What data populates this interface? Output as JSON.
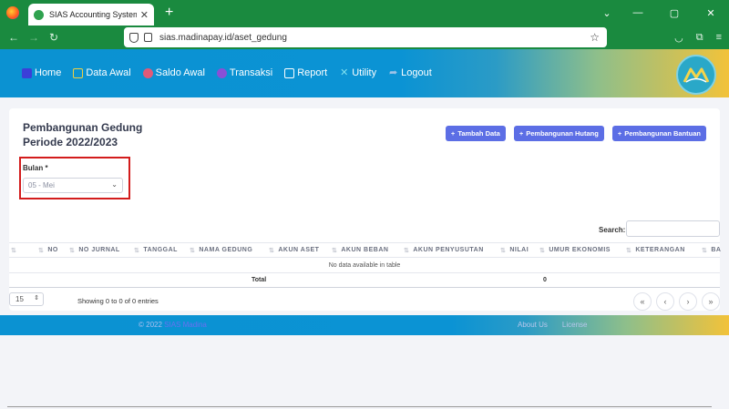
{
  "browser": {
    "tab_title": "SIAS Accounting System",
    "tab_close": "✕",
    "new_tab": "+",
    "url": "sias.madinapay.id/aset_gedung",
    "window_controls": [
      "⌄",
      "—",
      "▢",
      "✕"
    ]
  },
  "menu": {
    "items": [
      {
        "label": "Home",
        "icon": "home-icon",
        "color": "#3b3fd8"
      },
      {
        "label": "Data Awal",
        "icon": "monitor-icon",
        "color": "#f2d040"
      },
      {
        "label": "Saldo Awal",
        "icon": "wallet-icon",
        "color": "#e05a78"
      },
      {
        "label": "Transaksi",
        "icon": "transaction-icon",
        "color": "#8a4fd6"
      },
      {
        "label": "Report",
        "icon": "report-icon",
        "color": "#ffffff"
      },
      {
        "label": "Utility",
        "icon": "utility-icon",
        "color": "#7fe0f0"
      },
      {
        "label": "Logout",
        "icon": "logout-icon",
        "color": "#9fc3e8"
      }
    ]
  },
  "page": {
    "title_line1": "Pembangunan Gedung",
    "title_line2": "Periode 2022/2023"
  },
  "actions": {
    "tambah": "Tambah Data",
    "hutang": "Pembangunan Hutang",
    "bantuan": "Pembangunan Bantuan"
  },
  "filter": {
    "label": "Bulan *",
    "value": "05 - Mei"
  },
  "search": {
    "label": "Search:"
  },
  "table": {
    "columns": [
      "NO",
      "NO JURNAL",
      "TANGGAL",
      "NAMA GEDUNG",
      "AKUN ASET",
      "AKUN BEBAN",
      "AKUN PENYUSUTAN",
      "NILAI",
      "UMUR EKONOMIS",
      "KETERANGAN",
      "BA"
    ],
    "empty_message": "No data available in table",
    "total_label": "Total",
    "total_value": "0"
  },
  "pagination": {
    "length_value": "15",
    "info": "Showing 0 to 0 of 0 entries",
    "buttons": [
      "«",
      "‹",
      "›",
      "»"
    ]
  },
  "footer": {
    "copyright": "© 2022",
    "brand": "SIAS Madina",
    "about": "About Us",
    "license": "License"
  },
  "colors": {
    "primary_button": "#5c6ee5",
    "highlight_border": "#d31c1c",
    "browser_green": "#1a8a3f"
  }
}
